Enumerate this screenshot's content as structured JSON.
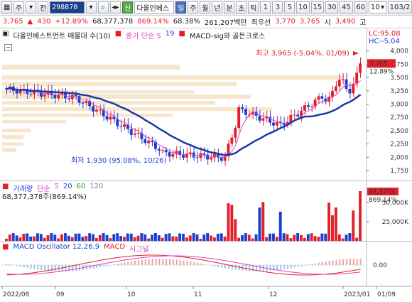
{
  "toolbar": {
    "items_left": [
      "주",
      "▾",
      "전"
    ],
    "code": "298870",
    "name": "다올인베스",
    "periods": [
      "일",
      "주",
      "월",
      "년",
      "분",
      "초",
      "틱"
    ],
    "numbers": [
      "1",
      "3",
      "5",
      "10",
      "15",
      "30",
      "45",
      "60"
    ],
    "dd_value": "10",
    "count": "103/2",
    "credit": "신"
  },
  "quote": {
    "price": "3,765",
    "arrow": "▲",
    "change": "430",
    "pct": "+12.89%",
    "volume": "68,377,378",
    "vol_pct": "869.14%",
    "ratio": "68.38%",
    "amount": "261,207백만",
    "best_label": "최우선",
    "ask": "3,770",
    "bid": "3,765",
    "open_label": "시",
    "open": "3,490",
    "extra": "고"
  },
  "price_pane": {
    "title": "다올인베스트먼트 매물대 수(10)",
    "ma_label": "종가 단순 5",
    "ma_val": "19",
    "macd_sig": "MACD-sig와 골든크로스",
    "lc": "LC:95.08",
    "hc": "HC:-5.04",
    "high_note": "최고 3,965 (-5.04%, 01/09)",
    "low_note": "최저 1,930 (95.08%, 10/26)",
    "cur_price": "3,765",
    "cur_pct": "12.89%",
    "yticks": [
      "4,000",
      "3,750",
      "3,500",
      "3,250",
      "3,000",
      "2,750",
      "2,500",
      "2,250",
      "2,000",
      "1,750"
    ]
  },
  "volume_pane": {
    "title": "거래량",
    "ma_label": "단순",
    "mas": [
      "5",
      "20",
      "60",
      "120"
    ],
    "value": "68,377,378주(869.14%)",
    "cur_vol": "68,377K",
    "cur_pct": "869.14%",
    "yticks": [
      "50,000K",
      "25,000K"
    ]
  },
  "macd_pane": {
    "title": "MACD Oscillator 12,26,9",
    "macd": "MACD",
    "signal": "시그널",
    "ytick": "0.00"
  },
  "xaxis": [
    "2022/08",
    "09",
    "10",
    "11",
    "12",
    "2023/01",
    "01/09"
  ],
  "colors": {
    "up": "#e0202a",
    "down": "#1b3fd0",
    "ma": "#e040c0",
    "trend": "#1a3aa8",
    "band": "#f7e6cc"
  }
}
